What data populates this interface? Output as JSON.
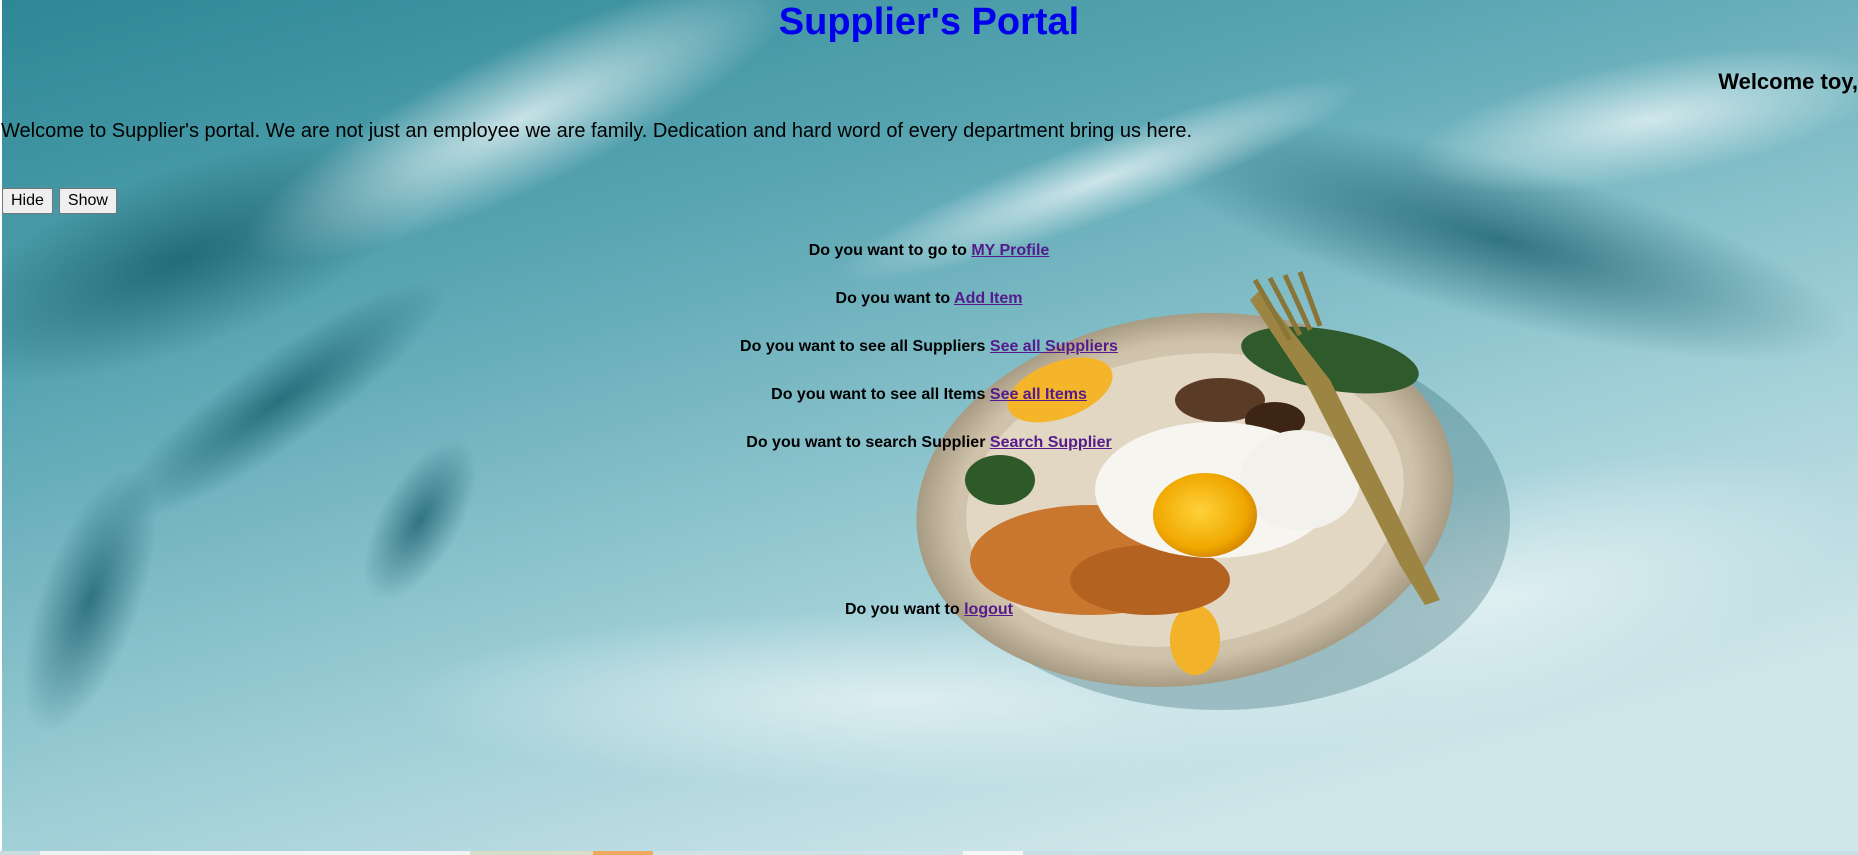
{
  "header": {
    "title": "Supplier's Portal",
    "welcome_user": "Welcome toy,"
  },
  "intro_text": "Welcome to Supplier's portal. We are not just an employee we are family. Dedication and hard word of every department bring us here.",
  "buttons": {
    "hide_label": "Hide",
    "show_label": "Show"
  },
  "nav_links": [
    {
      "prompt": "Do you want to go to",
      "link_text": "MY Profile"
    },
    {
      "prompt": "Do you want to",
      "link_text": "Add Item"
    },
    {
      "prompt": "Do you want to see all Suppliers",
      "link_text": "See all Suppliers"
    },
    {
      "prompt": "Do you want to see all Items",
      "link_text": "See all Items"
    },
    {
      "prompt": "Do you want to search Supplier",
      "link_text": "Search Supplier"
    },
    {
      "prompt": "Do you want to",
      "link_text": "logout"
    }
  ],
  "colors": {
    "title": "#0000ee",
    "visited_link": "#551a8b",
    "background": "#7fb8c4"
  },
  "background_image": "food-plate-egg-noodles-fork-on-teal-painted-surface"
}
